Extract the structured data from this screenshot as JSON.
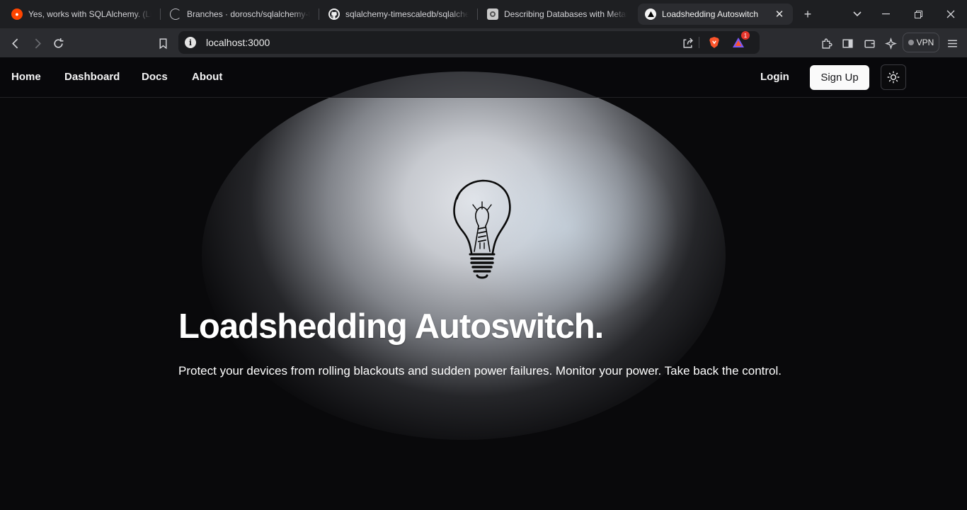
{
  "browser": {
    "tabs": [
      {
        "title": "Yes, works with SQLAlchemy. (Like",
        "icon": "reddit-icon"
      },
      {
        "title": "Branches · dorosch/sqlalchemy-ti",
        "icon": "loading-icon"
      },
      {
        "title": "sqlalchemy-timescaledb/sqlalche",
        "icon": "github-icon"
      },
      {
        "title": "Describing Databases with MetaD",
        "icon": "sqlalchemy-icon"
      },
      {
        "title": "Loadshedding Autoswitch",
        "icon": "vercel-icon",
        "active": true
      }
    ],
    "url": "localhost:3000",
    "vpn_label": "VPN",
    "notification_count": "1"
  },
  "nav": {
    "links": [
      "Home",
      "Dashboard",
      "Docs",
      "About"
    ],
    "login_label": "Login",
    "signup_label": "Sign Up"
  },
  "hero": {
    "title": "Loadshedding Autoswitch.",
    "subtitle": "Protect your devices from rolling blackouts and sudden power failures. Monitor your power. Take back the control."
  },
  "colors": {
    "page_bg": "#09090b",
    "tab_strip_bg": "#1e1f22",
    "toolbar_bg": "#2b2c30",
    "brave_orange": "#fb542b",
    "badge_red": "#e5352b"
  }
}
